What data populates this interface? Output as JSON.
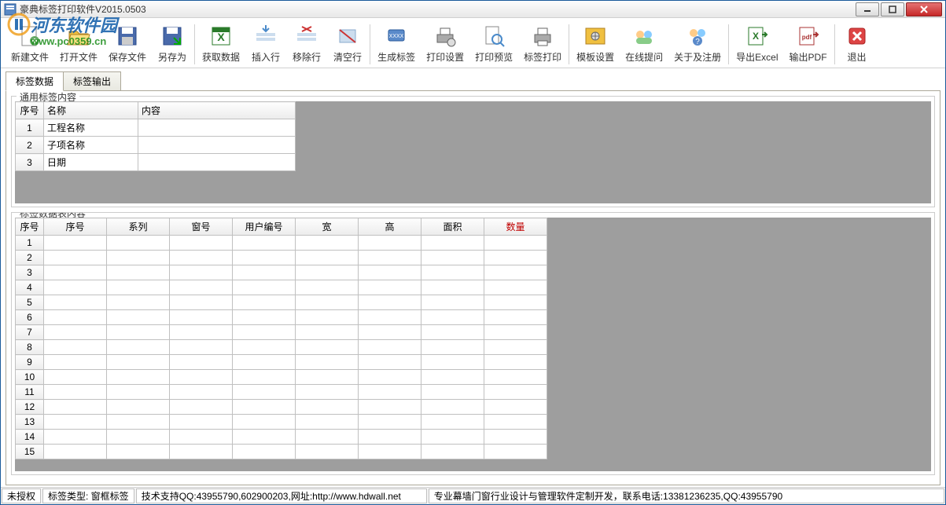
{
  "window": {
    "title": "豪典标签打印软件V2015.0503"
  },
  "watermark": {
    "text": "河东软件园",
    "url": "www.pc0359.cn"
  },
  "toolbar": [
    {
      "id": "new-file",
      "label": "新建文件",
      "icon": "file-new"
    },
    {
      "id": "open-file",
      "label": "打开文件",
      "icon": "file-open"
    },
    {
      "id": "save-file",
      "label": "保存文件",
      "icon": "file-save"
    },
    {
      "id": "save-as",
      "label": "另存为",
      "icon": "file-saveas"
    },
    {
      "id": "get-data",
      "label": "获取数据",
      "icon": "excel"
    },
    {
      "id": "insert-row",
      "label": "插入行",
      "icon": "row-insert"
    },
    {
      "id": "delete-row",
      "label": "移除行",
      "icon": "row-delete"
    },
    {
      "id": "clear",
      "label": "清空行",
      "icon": "clear"
    },
    {
      "id": "gen-label",
      "label": "生成标签",
      "icon": "gen"
    },
    {
      "id": "print-setup",
      "label": "打印设置",
      "icon": "print-setup"
    },
    {
      "id": "print-preview",
      "label": "打印预览",
      "icon": "preview"
    },
    {
      "id": "print-label",
      "label": "标签打印",
      "icon": "print"
    },
    {
      "id": "template",
      "label": "模板设置",
      "icon": "template"
    },
    {
      "id": "online-ask",
      "label": "在线提问",
      "icon": "ask"
    },
    {
      "id": "about-reg",
      "label": "关于及注册",
      "icon": "about"
    },
    {
      "id": "export-excel",
      "label": "导出Excel",
      "icon": "export-excel"
    },
    {
      "id": "export-pdf",
      "label": "输出PDF",
      "icon": "export-pdf"
    },
    {
      "id": "exit",
      "label": "退出",
      "icon": "exit"
    }
  ],
  "tabs": [
    {
      "id": "data",
      "label": "标签数据",
      "active": true
    },
    {
      "id": "output",
      "label": "标签输出",
      "active": false
    }
  ],
  "group1": {
    "title": "通用标签内容",
    "headers": [
      "序号",
      "名称",
      "内容"
    ],
    "rows": [
      {
        "num": "1",
        "name": "工程名称",
        "content": ""
      },
      {
        "num": "2",
        "name": "子项名称",
        "content": ""
      },
      {
        "num": "3",
        "name": "日期",
        "content": ""
      }
    ]
  },
  "group2": {
    "title": "标签数据表内容",
    "headers": [
      "序号",
      "序号",
      "系列",
      "窗号",
      "用户编号",
      "宽",
      "高",
      "面积",
      "数量"
    ],
    "qty_header": "数量",
    "row_count": 15
  },
  "status": {
    "auth": "未授权",
    "type": "标签类型: 窗框标签",
    "support": "技术支持QQ:43955790,602900203,网址:http://www.hdwall.net",
    "slogan": "专业幕墙门窗行业设计与管理软件定制开发，联系电话:13381236235,QQ:43955790"
  }
}
